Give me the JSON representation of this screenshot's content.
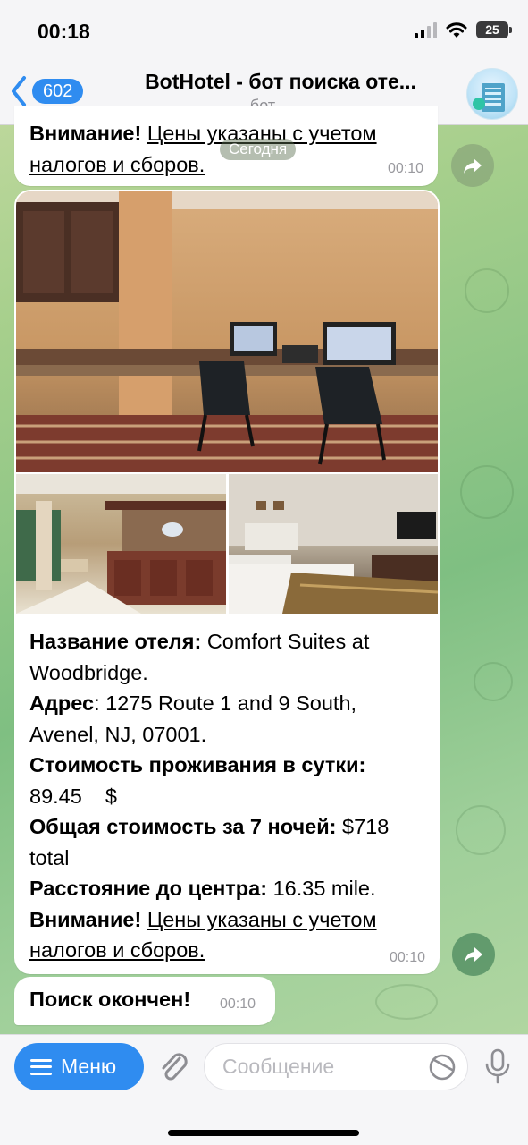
{
  "status_bar": {
    "time": "00:18",
    "battery": "25"
  },
  "header": {
    "back_count": "602",
    "title": "BotHotel - бот поиска оте...",
    "subtitle": "бот"
  },
  "messages": {
    "top": {
      "warning_label": "Внимание!",
      "warning_text": "Цены указаны с учетом налогов и сборов.",
      "time": "00:10",
      "date_pill": "Сегодня"
    },
    "hotel": {
      "name_label": "Название отеля:",
      "name_value": "Comfort Suites at Woodbridge.",
      "address_label": "Адрес",
      "address_value": ": 1275 Route 1 and 9 South, Avenel, NJ, 07001.",
      "price_label": "Стоимость проживания в сутки:",
      "price_value": "89.45    $",
      "total_label": "Общая стоимость за 7 ночей:",
      "total_value": "$718 total",
      "distance_label": "Расстояние до центра:",
      "distance_value": " 16.35 mile.",
      "warning_label": "Внимание!",
      "warning_text": "Цены указаны с учетом налогов и сборов.",
      "time": "00:10",
      "photos": [
        "business-center-photo",
        "lobby-reception-photo",
        "guest-room-photo"
      ]
    },
    "end": {
      "text": "Поиск окончен!",
      "time": "00:10"
    }
  },
  "input_bar": {
    "menu_label": "Меню",
    "placeholder": "Сообщение"
  },
  "colors": {
    "accent": "#2f8cf0",
    "bubble": "#ffffff",
    "time_text": "#9a9a9f"
  }
}
